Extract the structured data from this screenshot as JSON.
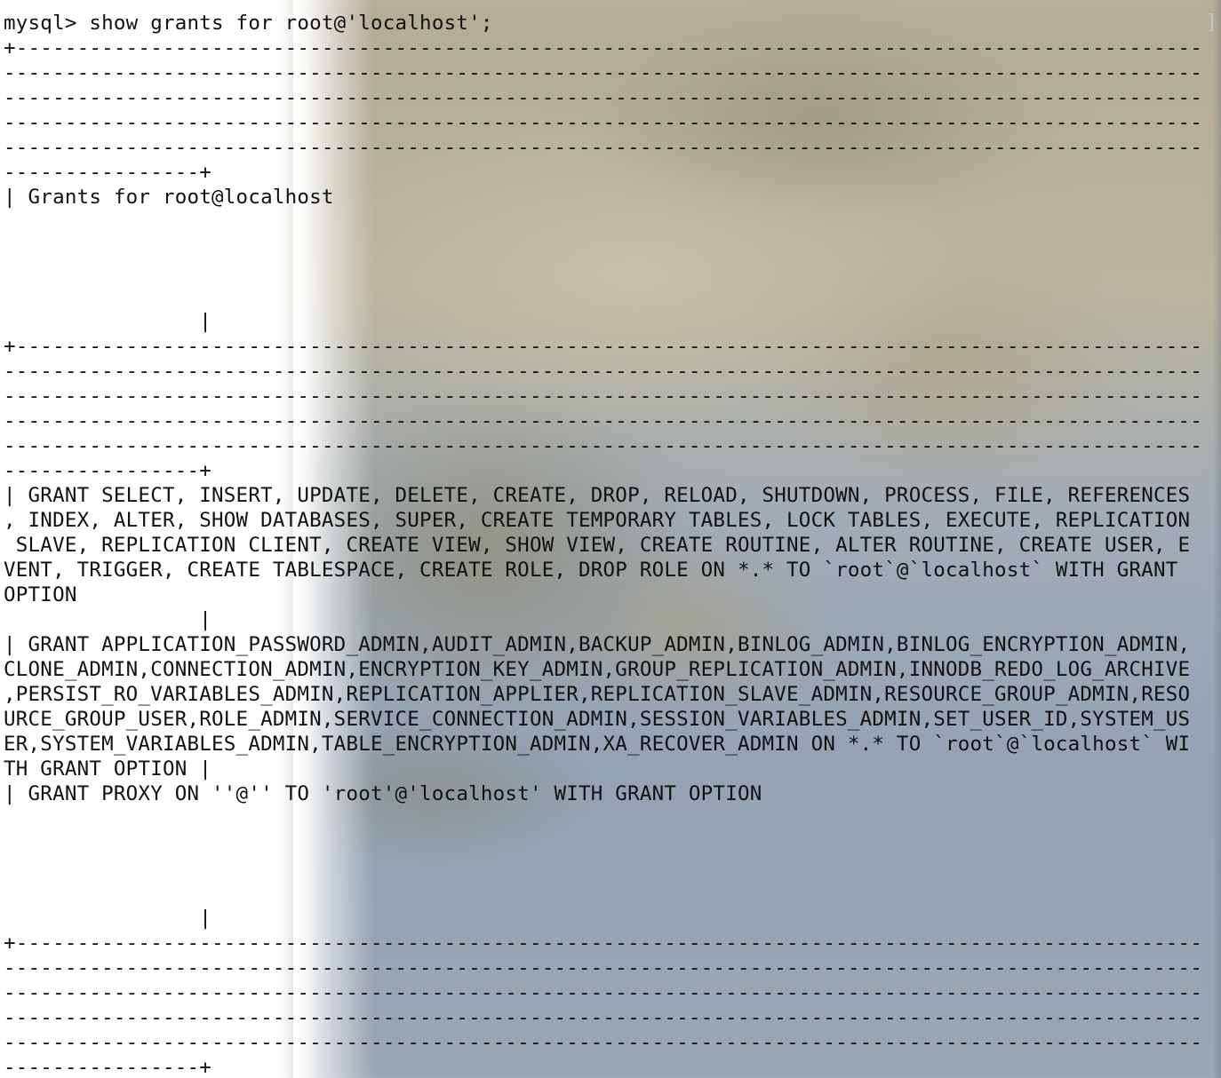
{
  "terminal": {
    "prompt": "mysql> show grants for root@'localhost';",
    "lines": [
      "+-------------------------------------------------------------------------------------------------",
      "--------------------------------------------------------------------------------------------------",
      "--------------------------------------------------------------------------------------------------",
      "--------------------------------------------------------------------------------------------------",
      "--------------------------------------------------------------------------------------------------",
      "----------------+",
      "| Grants for root@localhost",
      "",
      "",
      "",
      "",
      "                |",
      "+-------------------------------------------------------------------------------------------------",
      "--------------------------------------------------------------------------------------------------",
      "--------------------------------------------------------------------------------------------------",
      "--------------------------------------------------------------------------------------------------",
      "--------------------------------------------------------------------------------------------------",
      "----------------+",
      "| GRANT SELECT, INSERT, UPDATE, DELETE, CREATE, DROP, RELOAD, SHUTDOWN, PROCESS, FILE, REFERENCES",
      ", INDEX, ALTER, SHOW DATABASES, SUPER, CREATE TEMPORARY TABLES, LOCK TABLES, EXECUTE, REPLICATION",
      " SLAVE, REPLICATION CLIENT, CREATE VIEW, SHOW VIEW, CREATE ROUTINE, ALTER ROUTINE, CREATE USER, E",
      "VENT, TRIGGER, CREATE TABLESPACE, CREATE ROLE, DROP ROLE ON *.* TO `root`@`localhost` WITH GRANT",
      "OPTION",
      "                |",
      "| GRANT APPLICATION_PASSWORD_ADMIN,AUDIT_ADMIN,BACKUP_ADMIN,BINLOG_ADMIN,BINLOG_ENCRYPTION_ADMIN,",
      "CLONE_ADMIN,CONNECTION_ADMIN,ENCRYPTION_KEY_ADMIN,GROUP_REPLICATION_ADMIN,INNODB_REDO_LOG_ARCHIVE",
      ",PERSIST_RO_VARIABLES_ADMIN,REPLICATION_APPLIER,REPLICATION_SLAVE_ADMIN,RESOURCE_GROUP_ADMIN,RESO",
      "URCE_GROUP_USER,ROLE_ADMIN,SERVICE_CONNECTION_ADMIN,SESSION_VARIABLES_ADMIN,SET_USER_ID,SYSTEM_US",
      "ER,SYSTEM_VARIABLES_ADMIN,TABLE_ENCRYPTION_ADMIN,XA_RECOVER_ADMIN ON *.* TO `root`@`localhost` WI",
      "TH GRANT OPTION |",
      "| GRANT PROXY ON ''@'' TO 'root'@'localhost' WITH GRANT OPTION",
      "",
      "",
      "",
      "",
      "                |",
      "+-------------------------------------------------------------------------------------------------",
      "--------------------------------------------------------------------------------------------------",
      "--------------------------------------------------------------------------------------------------",
      "--------------------------------------------------------------------------------------------------",
      "--------------------------------------------------------------------------------------------------",
      "----------------+"
    ]
  },
  "scroll_marker": "]"
}
